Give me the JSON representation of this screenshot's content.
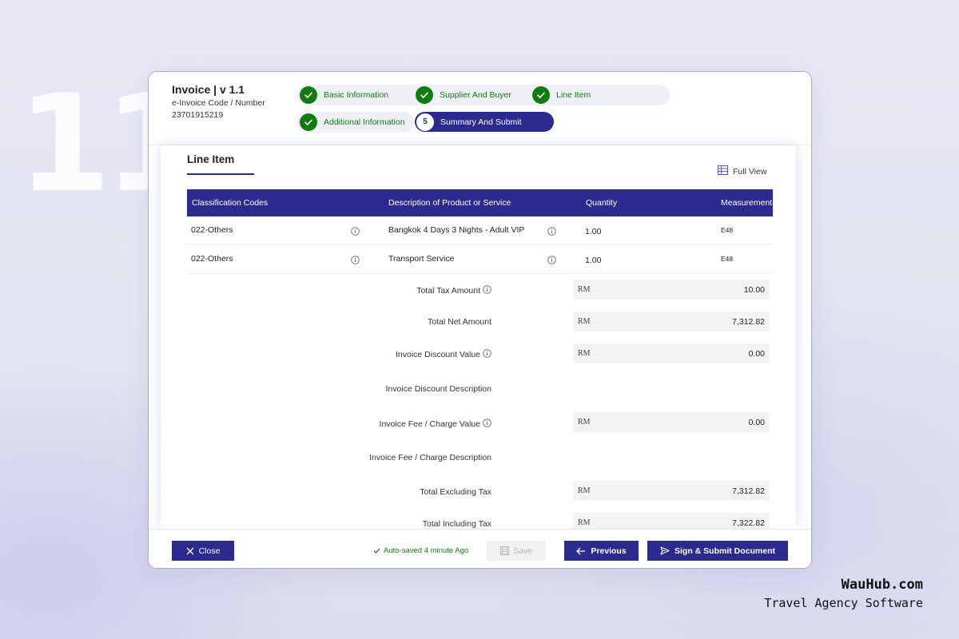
{
  "background_number": "11",
  "brand": {
    "name": "WauHub.com",
    "tagline": "Travel Agency Software"
  },
  "colors": {
    "primary": "#2b2b8f",
    "success": "#107c10",
    "window_border": "#e58bc0"
  },
  "invoice": {
    "title": "Invoice | v 1.1",
    "code_label": "e-Invoice Code / Number",
    "code_number": "23701915219"
  },
  "steps": [
    {
      "label": "Basic Information",
      "status": "complete",
      "icon": "check-icon"
    },
    {
      "label": "Supplier And Buyer",
      "status": "complete",
      "icon": "check-icon"
    },
    {
      "label": "Line Item",
      "status": "complete",
      "icon": "check-icon"
    },
    {
      "label": "Additional Information",
      "status": "complete",
      "icon": "check-icon"
    },
    {
      "label": "Summary And Submit",
      "status": "active",
      "number": "5"
    }
  ],
  "section": {
    "title": "Line Item",
    "full_view_label": "Full View",
    "full_view_icon": "table-grid-icon"
  },
  "table": {
    "columns": [
      "Classification Codes",
      "Description of Product or Service",
      "Quantity",
      "Measurement"
    ],
    "rows": [
      {
        "classification": "022-Others",
        "description": "Bangkok 4 Days 3 Nights - Adult VIP",
        "quantity": "1.00",
        "measurement": "E48"
      },
      {
        "classification": "022-Others",
        "description": "Transport Service",
        "quantity": "1.00",
        "measurement": "E48"
      }
    ]
  },
  "summary": {
    "currency": "RM",
    "total_tax_label": "Total Tax Amount",
    "total_tax_value": "10.00",
    "total_net_label": "Total Net Amount",
    "total_net_value": "7,312.82",
    "discount_value_label": "Invoice Discount Value",
    "discount_value": "0.00",
    "discount_desc_label": "Invoice Discount Description",
    "fee_value_label": "Invoice Fee / Charge Value",
    "fee_value": "0.00",
    "fee_desc_label": "Invoice Fee / Charge Description",
    "total_excl_label": "Total Excluding Tax",
    "total_excl_value": "7,312.82",
    "total_incl_label": "Total Including Tax",
    "total_incl_value": "7,322.82"
  },
  "footer": {
    "close_label": "Close",
    "autosave_text": "Auto-saved 4 minute Ago",
    "save_label": "Save",
    "previous_label": "Previous",
    "submit_label": "Sign & Submit Document"
  }
}
